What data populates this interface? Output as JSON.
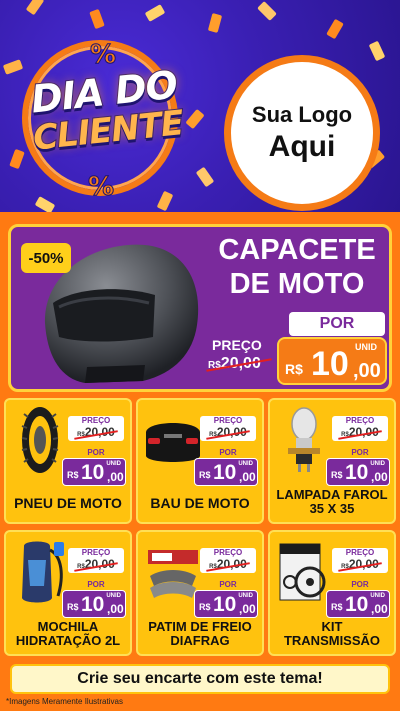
{
  "header": {
    "badge_line1": "DIA DO",
    "badge_line2": "CLIENTE",
    "percent_symbol": "%",
    "logo_line1": "Sua Logo",
    "logo_line2": "Aqui"
  },
  "featured": {
    "discount": "-50%",
    "title_line1": "CAPACETE",
    "title_line2": "DE MOTO",
    "por_label": "POR",
    "preco_label": "PREÇO",
    "old_currency": "R$",
    "old_price": "20,00",
    "currency": "R$",
    "price_int": "10",
    "price_dec": ",00",
    "unit": "UNID"
  },
  "labels": {
    "preco": "PREÇO",
    "por": "POR",
    "unit": "UNID",
    "currency": "R$",
    "old_price": "20,00",
    "price_int": "10",
    "price_dec": ",00"
  },
  "products": [
    {
      "name": "PNEU DE MOTO"
    },
    {
      "name": "BAU DE MOTO"
    },
    {
      "name": "LAMPADA FAROL 35 X 35"
    },
    {
      "name": "MOCHILA HIDRATAÇÃO 2L"
    },
    {
      "name": "PATIM DE FREIO DIAFRAG"
    },
    {
      "name": "KIT TRANSMISSÃO"
    }
  ],
  "cta": "Crie seu encarte com este tema!",
  "disclaimer": "*Imagens Meramente Ilustrativas",
  "colors": {
    "purple": "#7a2a9c",
    "orange": "#f57b16",
    "yellow": "#ffc20e",
    "header_blue": "#3a1fb3"
  }
}
